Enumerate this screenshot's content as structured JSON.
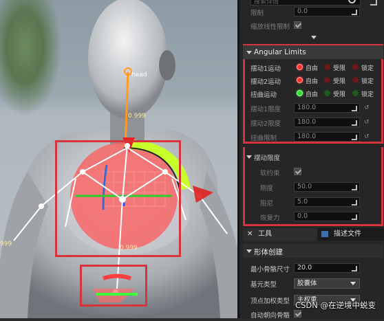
{
  "viewport": {
    "bone_label": "head",
    "value_top": "0.999",
    "value_bottom": "0.999",
    "value_left": "999"
  },
  "panel": {
    "search_placeholder": "搜索详情",
    "top_rows": [
      {
        "label": "限制",
        "value": "0.0"
      },
      {
        "label": "缩放线性限制",
        "checked": true
      }
    ],
    "angular_limits": {
      "title": "Angular Limits",
      "motion_rows": [
        {
          "label": "摆动1运动",
          "options": [
            "自由",
            "受限",
            "锁定"
          ],
          "selected": 0,
          "color": "red"
        },
        {
          "label": "摆动2运动",
          "options": [
            "自由",
            "受限",
            "锁定"
          ],
          "selected": 0,
          "color": "red"
        },
        {
          "label": "扭曲运动",
          "options": [
            "自由",
            "受限",
            "锁定"
          ],
          "selected": 0,
          "color": "green"
        }
      ],
      "limit_rows": [
        {
          "label": "摆动1限度",
          "value": "180.0"
        },
        {
          "label": "摆动2限度",
          "value": "180.0"
        },
        {
          "label": "扭曲限制",
          "value": "180.0"
        }
      ]
    },
    "swing_limit": {
      "title": "摆动限度",
      "rows": [
        {
          "label": "软约束",
          "checked": true
        },
        {
          "label": "刚度",
          "value": "50.0"
        },
        {
          "label": "阻尼",
          "value": "5.0"
        },
        {
          "label": "恢复力",
          "value": "0.0"
        }
      ]
    },
    "tabs": [
      {
        "label": "工具",
        "icon": "wrench-icon"
      },
      {
        "label": "描述文件",
        "icon": "profile-icon"
      }
    ],
    "body_creation": {
      "title": "形体创建",
      "rows": [
        {
          "label": "最小骨骼尺寸",
          "value": "20.0"
        },
        {
          "label": "基元类型",
          "value": "胶囊体"
        },
        {
          "label": "顶点加权类型",
          "value": "主权重"
        },
        {
          "label": "自动朝向骨骼",
          "checked": true
        }
      ]
    },
    "watermark": "CSDN @在逆境中蜕变"
  }
}
